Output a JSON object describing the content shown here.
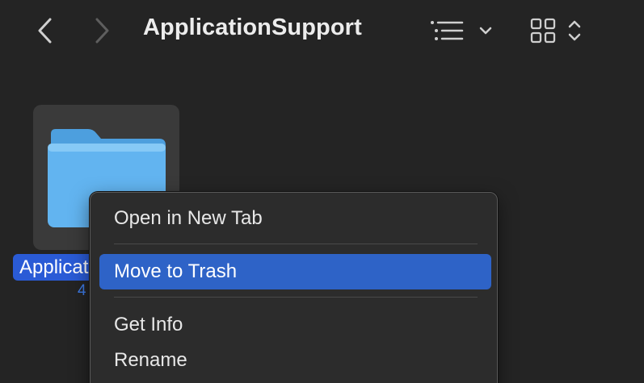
{
  "window": {
    "title": "ApplicationSupport"
  },
  "toolbar": {
    "back_icon": "chevron-left-icon",
    "forward_icon": "chevron-right-icon",
    "list_view_icon": "list-icon",
    "list_view_dropdown_icon": "chevron-down-icon",
    "grid_view_icon": "grid-icon",
    "grid_view_stepper_icon": "chevron-up-down-icon"
  },
  "items": [
    {
      "name": "Applicat",
      "meta": "4",
      "icon": "folder-icon",
      "selected": true
    }
  ],
  "context_menu": {
    "items": [
      {
        "label": "Open in New Tab",
        "highlighted": false
      },
      {
        "label": "Move to Trash",
        "highlighted": true
      },
      {
        "label": "Get Info",
        "highlighted": false
      },
      {
        "label": "Rename",
        "highlighted": false
      }
    ]
  },
  "colors": {
    "background": "#242424",
    "selection_blue": "#2e63c7",
    "folder_blue": "#6ab8f0",
    "menu_background": "#2c2c2c"
  }
}
